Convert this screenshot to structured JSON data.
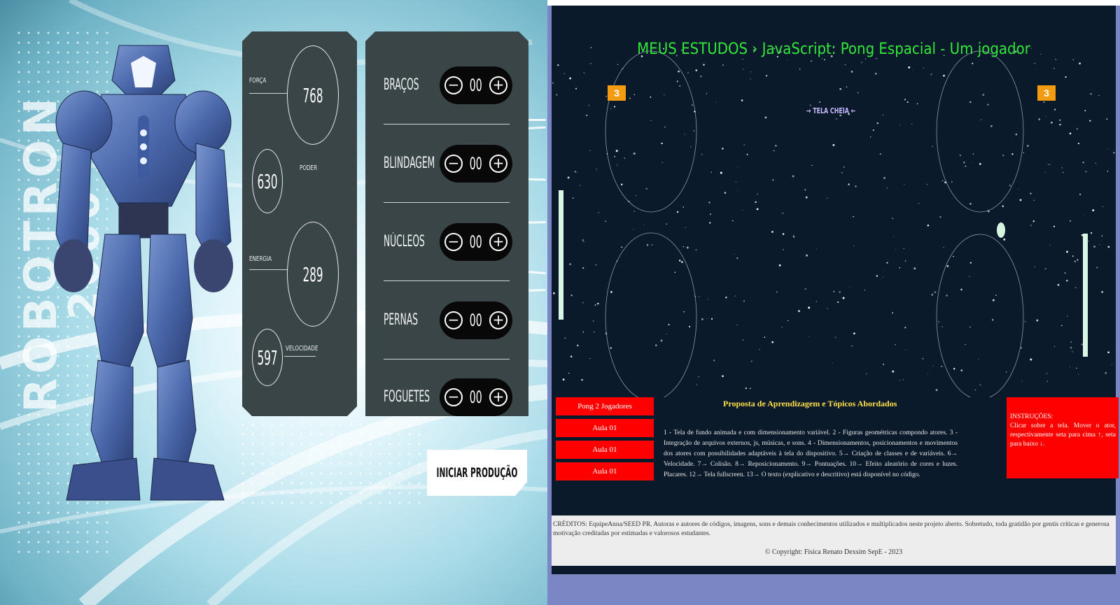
{
  "robotron": {
    "vertical_title_line1": "ROBOTRON",
    "vertical_title_line2": "2000",
    "stats": [
      {
        "label": "FORÇA",
        "value": "768"
      },
      {
        "label": "PODER",
        "value": "630"
      },
      {
        "label": "ENERGIA",
        "value": "289"
      },
      {
        "label": "VELOCIDADE",
        "value": "597"
      }
    ],
    "parts": [
      {
        "label": "BRAÇOS",
        "value": "00"
      },
      {
        "label": "BLINDAGEM",
        "value": "00"
      },
      {
        "label": "NÚCLEOS",
        "value": "00"
      },
      {
        "label": "PERNAS",
        "value": "00"
      },
      {
        "label": "FOGUETES",
        "value": "00"
      }
    ],
    "minus_symbol": "−",
    "plus_symbol": "+",
    "start_button": "INICIAR PRODUÇÃO"
  },
  "pong": {
    "title": "MEUS ESTUDOS   › JavaScript: Pong Espacial - Um jogador",
    "score_left": "3",
    "score_right": "3",
    "fullscreen_link": "→ TELA CHEIA ←",
    "menu": [
      "Pong 2 Jogadores",
      "Aula 01",
      "Aula 01",
      "Aula 01"
    ],
    "proposal_title": "Proposta de Aprendizagem e Tópicos Abordados",
    "proposal_text": "1 - Tela de fundo animada e com dimensionamento variável. 2 - Figuras geométricas compondo atores. 3 - Integração de arquivos externos, js, músicas, e sons. 4 - Dimensionamentos, posicionamentos e movimentos dos atores com possibilidades adaptáveis à tela do dispositivo. 5→ Criação de classes e de variáveis. 6→ Velocidade. 7→ Colisão. 8→ Reposicionamento. 9→ Pontuações. 10→ Efeito aleatório de cores e luzes. Placares. 12→ Tela fullscreen. 13→ O texto (explicativo e descritivo) está disponível no código.",
    "instructions_title": "INSTRUÇÕES:",
    "instructions_text": "Clicar sobre a tela. Mover o ator, respectivamente seta para cima ↑, seta para baixo ↓.",
    "credits": "CRÉDITOS: EquipeAnna/SEED PR. Autoras e autores de códigos, imagens, sons e demais conhecimentos utilizados e multiplicados neste projeto aberto. Sobretudo, toda gratidão por gentis críticas e generosa motivação creditadas por estimadas e valorosos estudantes.",
    "copyright": "© Copyright: Física Renato Dexsim SepE - 2023"
  }
}
